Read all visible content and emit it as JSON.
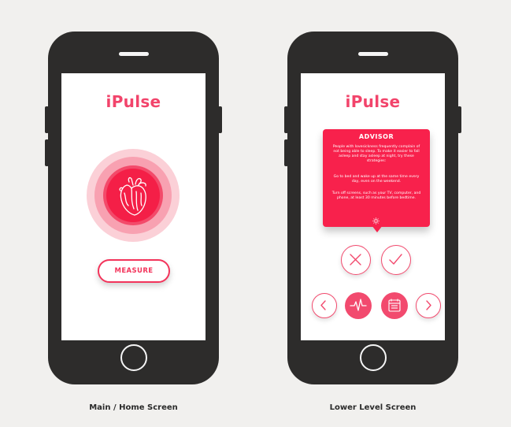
{
  "colors": {
    "background": "#f1f0ee",
    "phone_body": "#2d2c2b",
    "accent": "#f2446b",
    "advisor_bg": "#f8214c"
  },
  "home_screen": {
    "app_title": "iPulse",
    "measure_button_label": "MEASURE",
    "heart_icon": "heart-anatomical-icon",
    "caption": "Main / Home Screen"
  },
  "lower_screen": {
    "app_title": "iPulse",
    "advisor": {
      "title": "ADVISOR",
      "paragraph_1": "People with lovesickness frequently complain of not being able to sleep. To make it easier to fall asleep and stay asleep at night, try these strategies:",
      "paragraph_2": "Go to bed and wake up at the same time every day, even on the weekend.",
      "paragraph_3": "Turn off screens, such as your TV, computer, and phone, at least 30 minutes before bedtime.",
      "icon": "sun-icon"
    },
    "buttons": {
      "dismiss_icon": "close-icon",
      "accept_icon": "check-icon",
      "prev_icon": "chevron-left-icon",
      "pulse_icon": "heartbeat-icon",
      "calendar_icon": "calendar-icon",
      "next_icon": "chevron-right-icon"
    },
    "caption": "Lower Level Screen"
  }
}
